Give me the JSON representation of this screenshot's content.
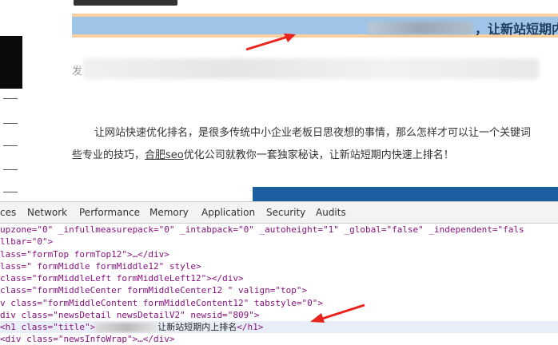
{
  "article": {
    "title_suffix": "，让新站短期内上排名",
    "meta_prefix": "发",
    "para1": "让网站快速优化排名，是很多传统中小企业老板日思夜想的事情，那么怎样才可以让一个关键词",
    "para2_a": "些专业的技巧，",
    "para2_link": "合肥seo",
    "para2_b": "优化公司就教你一套独家秘诀，让新站短期内快速上排名！"
  },
  "devtools": {
    "tabs": [
      "ces",
      "Network",
      "Performance",
      "Memory",
      "Application",
      "Security",
      "Audits"
    ],
    "lines": {
      "l0": "upzone=\"0\" _infullmeasurepack=\"0\" _intabpack=\"0\" _autoheight=\"1\" _global=\"false\" _independent=\"fals",
      "l1": "llbar=\"0\">",
      "l2": "lass=\"formTop formTop12\">…</div>",
      "l3": "lass=\" formMiddle formMiddle12\" style>",
      "l4": " class=\"formMiddleLeft formMiddleLeft12\"></div>",
      "l5": " class=\"formMiddleCenter formMiddleCenter12 \" valign=\"top\">",
      "l6": "v class=\"formMiddleContent formMiddleContent12\" tabstyle=\"0\">",
      "l7": "div class=\"newsDetail newsDetailV2\" newsid=\"809\">",
      "l8_open": " <h1 class=\"title\">",
      "l8_text": "让新站短期内上排名",
      "l8_close": "</h1>",
      "l9": " <div class=\"newsInfoWrap\">…</div>"
    }
  },
  "colors": {
    "title_highlight": "#9fc4e8",
    "title_padding": "#f7cfa0",
    "arrow": "#e8231b"
  }
}
